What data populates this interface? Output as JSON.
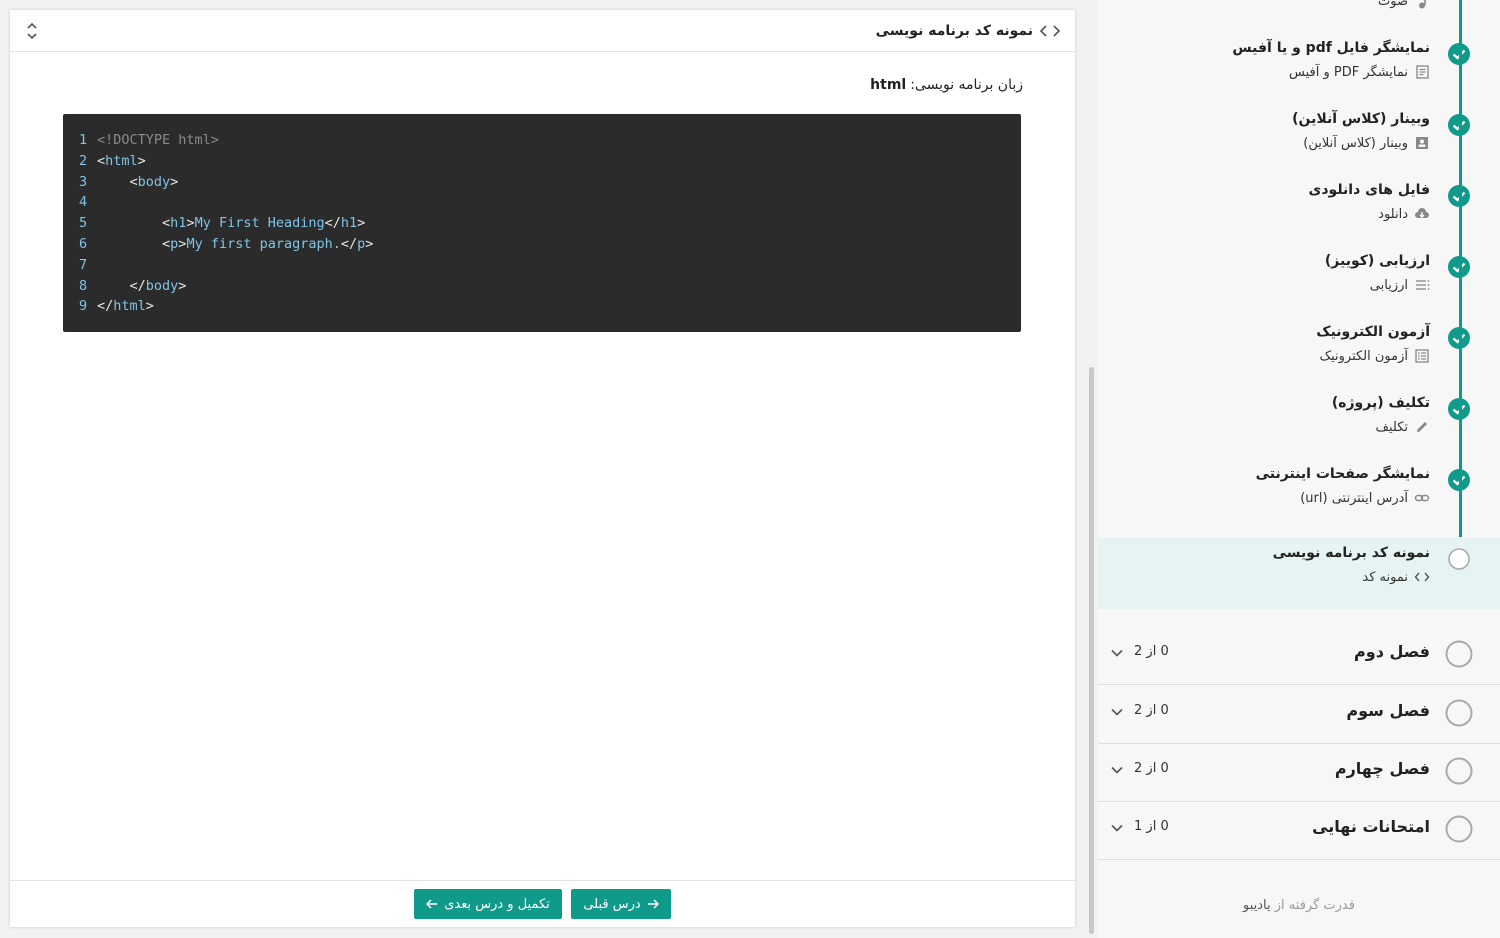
{
  "main": {
    "title": "نمونه کد برنامه نویسی",
    "language_label": "زبان برنامه نویسی:",
    "language_value": "html",
    "code_lines": [
      {
        "n": "1",
        "tokens": [
          {
            "t": "<!DOCTYPE html>",
            "c": "doctype"
          }
        ]
      },
      {
        "n": "2",
        "tokens": [
          {
            "t": "<",
            "c": "bracket"
          },
          {
            "t": "html",
            "c": "tag"
          },
          {
            "t": ">",
            "c": "bracket"
          }
        ]
      },
      {
        "n": "3",
        "tokens": [
          {
            "t": "    <",
            "c": "bracket"
          },
          {
            "t": "body",
            "c": "tag"
          },
          {
            "t": ">",
            "c": "bracket"
          }
        ]
      },
      {
        "n": "4",
        "tokens": []
      },
      {
        "n": "5",
        "tokens": [
          {
            "t": "        <",
            "c": "bracket"
          },
          {
            "t": "h1",
            "c": "tag"
          },
          {
            "t": ">",
            "c": "bracket"
          },
          {
            "t": "My First Heading",
            "c": "text"
          },
          {
            "t": "</",
            "c": "bracket"
          },
          {
            "t": "h1",
            "c": "tag"
          },
          {
            "t": ">",
            "c": "bracket"
          }
        ]
      },
      {
        "n": "6",
        "tokens": [
          {
            "t": "        <",
            "c": "bracket"
          },
          {
            "t": "p",
            "c": "tag"
          },
          {
            "t": ">",
            "c": "bracket"
          },
          {
            "t": "My first paragraph.",
            "c": "text"
          },
          {
            "t": "</",
            "c": "bracket"
          },
          {
            "t": "p",
            "c": "tag"
          },
          {
            "t": ">",
            "c": "bracket"
          }
        ]
      },
      {
        "n": "7",
        "tokens": []
      },
      {
        "n": "8",
        "tokens": [
          {
            "t": "    </",
            "c": "bracket"
          },
          {
            "t": "body",
            "c": "tag"
          },
          {
            "t": ">",
            "c": "bracket"
          }
        ]
      },
      {
        "n": "9",
        "tokens": [
          {
            "t": "</",
            "c": "bracket"
          },
          {
            "t": "html",
            "c": "tag"
          },
          {
            "t": ">",
            "c": "bracket"
          }
        ]
      }
    ],
    "footer": {
      "prev_label": "درس قبلی",
      "next_label": "تکمیل و درس بعدی"
    }
  },
  "sidebar": {
    "lessons": [
      {
        "title": "",
        "subtitle": "صوت",
        "icon": "music-note-icon",
        "done": true
      },
      {
        "title": "نمایشگر فایل pdf و یا آفیس",
        "subtitle": "نمایشگر PDF و آفیس",
        "icon": "document-icon",
        "done": true
      },
      {
        "title": "وبینار (کلاس آنلاین)",
        "subtitle": "وبینار (کلاس آنلاین)",
        "icon": "contact-card-icon",
        "done": true
      },
      {
        "title": "فایل های دانلودی",
        "subtitle": "دانلود",
        "icon": "cloud-download-icon",
        "done": true
      },
      {
        "title": "ارزیابی (کوییز)",
        "subtitle": "ارزیابی",
        "icon": "checklist-icon",
        "done": true
      },
      {
        "title": "آزمون الکترونیک",
        "subtitle": "آزمون الکترونیک",
        "icon": "list-box-icon",
        "done": true
      },
      {
        "title": "تکلیف (پروژه)",
        "subtitle": "تکلیف",
        "icon": "pencil-icon",
        "done": true
      },
      {
        "title": "نمایشگر صفحات اینترنتی",
        "subtitle": "آدرس اینترنتی (url)",
        "icon": "link-icon",
        "done": true
      },
      {
        "title": "نمونه کد برنامه نویسی",
        "subtitle": "نمونه کد",
        "icon": "code-icon",
        "done": false,
        "active": true
      }
    ],
    "sections": [
      {
        "title": "فصل دوم",
        "count": "0 از 2"
      },
      {
        "title": "فصل سوم",
        "count": "0 از 2"
      },
      {
        "title": "فصل چهارم",
        "count": "0 از 2"
      },
      {
        "title": "امتحانات نهایی",
        "count": "0 از 1"
      }
    ],
    "powered_prefix": "قدرت گرفته از",
    "powered_brand": "یادیبو"
  },
  "colors": {
    "accent": "#109a8a",
    "active_bg": "#e5f4f2",
    "code_bg": "#2b2b2b",
    "code_tag": "#7ec5e8"
  }
}
